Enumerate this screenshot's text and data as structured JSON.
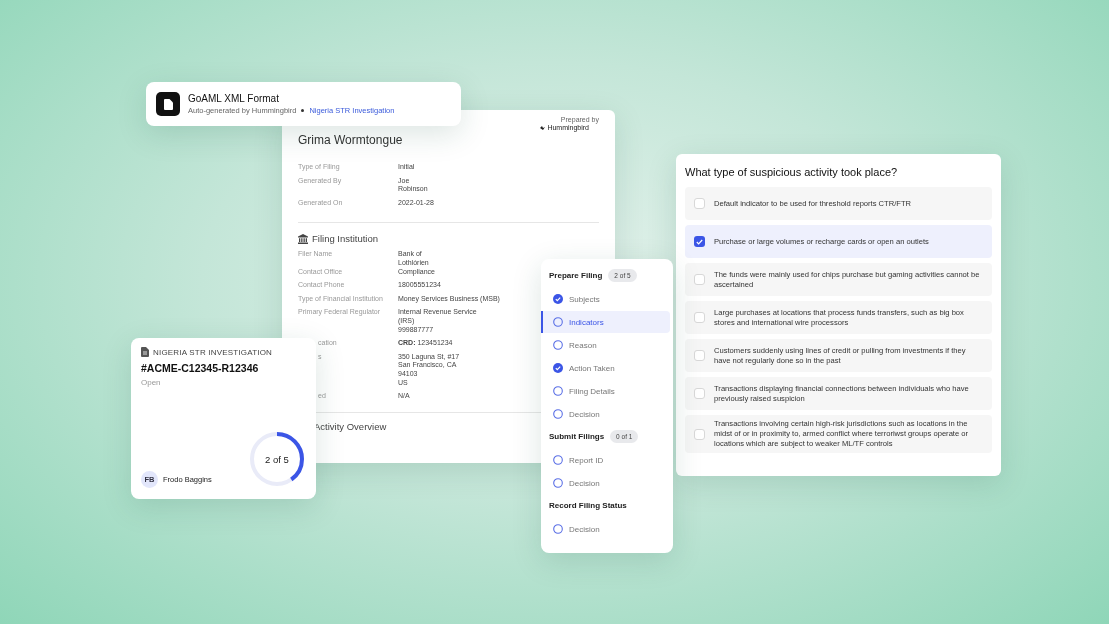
{
  "format_card": {
    "title": "GoAML XML Format",
    "subtitle": "Auto-generated by Hummingbird",
    "link": "Nigeria STR Investigation"
  },
  "report": {
    "prepared_by": "Prepared by",
    "brand": "Hummingbird",
    "name": "Grima Wormtongue",
    "meta": [
      {
        "label": "Type of Filing",
        "lines": [
          "Initial"
        ]
      },
      {
        "label": "Generated By",
        "lines": [
          "Joe",
          "Robinson"
        ]
      },
      {
        "label": "Generated On",
        "lines": [
          "2022-01-28"
        ]
      }
    ],
    "section": "Filing Institution",
    "rows": [
      {
        "label": "Filer Name",
        "lines": [
          "Bank of",
          "Lothlórien"
        ],
        "partial": false
      },
      {
        "label": "Contact Office",
        "lines": [
          "Compliance"
        ],
        "partial": false
      },
      {
        "label": "Contact Phone",
        "lines": [
          "18005551234"
        ],
        "partial": false
      },
      {
        "label": "Type of Financial Institution",
        "lines": [
          "Money Services Business (MSB)"
        ],
        "partial": false
      },
      {
        "label": "Primary Federal Regulator",
        "lines": [
          "Internal Revenue Service",
          "(IRS)",
          "999887777"
        ],
        "partial": false
      },
      {
        "label": "cation",
        "lines": [
          "**CRD:** 123451234"
        ],
        "partial": true
      },
      {
        "label": "s",
        "lines": [
          "350 Laguna St, #17",
          "San Francisco, CA",
          "94103",
          "US"
        ],
        "partial": true
      },
      {
        "label": "ed",
        "lines": [
          "N/A"
        ],
        "partial": true
      }
    ],
    "next_section": "Activity Overview"
  },
  "case_card": {
    "category": "NIGERIA STR INVESTIGATION",
    "case_id": "#ACME-C12345-R12346",
    "status": "Open",
    "assignee_initials": "FB",
    "assignee": "Frodo Baggins",
    "progress": {
      "label": "2 of 5",
      "level": 0.4
    }
  },
  "steps": {
    "groups": [
      {
        "title": "Prepare Filing",
        "badge": "2 of 5",
        "items": [
          {
            "label": "Subjects",
            "done": true,
            "selected": false
          },
          {
            "label": "Indicators",
            "done": false,
            "selected": true
          },
          {
            "label": "Reason",
            "done": false,
            "selected": false
          },
          {
            "label": "Action Taken",
            "done": true,
            "selected": false
          },
          {
            "label": "Filing Details",
            "done": false,
            "selected": false
          },
          {
            "label": "Decision",
            "done": false,
            "selected": false
          }
        ]
      },
      {
        "title": "Submit Filings",
        "badge": "0 of 1",
        "items": [
          {
            "label": "Report ID",
            "done": false,
            "selected": false
          },
          {
            "label": "Decision",
            "done": false,
            "selected": false
          }
        ]
      },
      {
        "title": "Record Filing Status",
        "items": [
          {
            "label": "Decision",
            "done": false,
            "selected": false
          }
        ]
      }
    ]
  },
  "question": {
    "title": "What type of suspicious activity took place?",
    "options": [
      {
        "label": "Default indicator to be used for threshold reports CTR/FTR",
        "checked": false
      },
      {
        "label": "Purchase or large volumes or recharge cards or open an outlets",
        "checked": true
      },
      {
        "label": "The funds were mainly used for chips purchase but gaming activities cannot be ascertained",
        "checked": false
      },
      {
        "label": "Large purchases at locations that process funds transfers, such as big box stores and international wire processors",
        "checked": false
      },
      {
        "label": "Customers suddenly using lines of credit or pulling from investments if they have not regularly done so in the past",
        "checked": false
      },
      {
        "label": "Transactions displaying financial connections between individuals who have previously raised suspicion",
        "checked": false
      },
      {
        "label": "Transactions involving certain high-risk jurisdictions such as locations in the midst of or in proximity to, armed conflict where terroriwst groups operate or locations which are subject to weaker ML/TF controls",
        "checked": false
      }
    ]
  }
}
